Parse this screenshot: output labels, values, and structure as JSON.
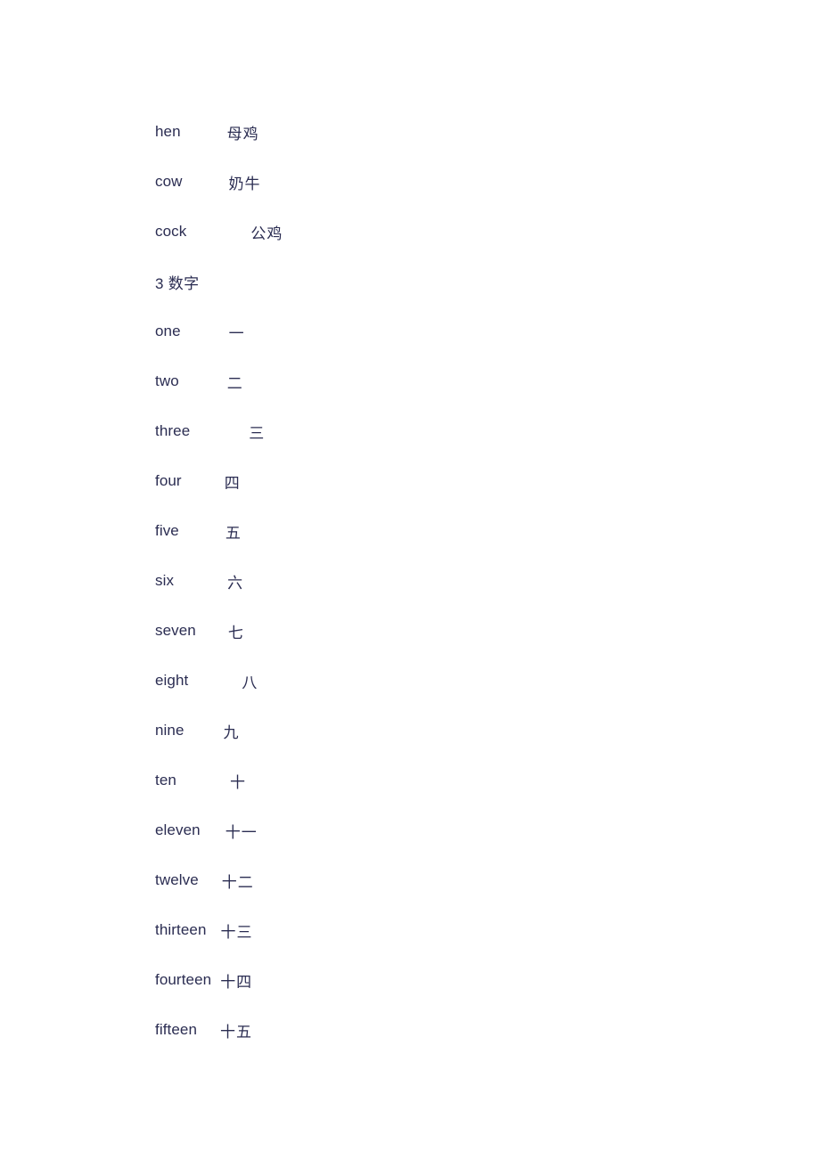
{
  "document": {
    "text_color": "#2b2d52",
    "background_color": "#ffffff",
    "blocks": [
      {
        "kind": "entry",
        "term": "hen",
        "gloss": "母鸡",
        "gap": 52
      },
      {
        "kind": "entry",
        "term": "cow",
        "gloss": "奶牛",
        "gap": 52
      },
      {
        "kind": "entry",
        "term": "cock",
        "gloss": "公鸡",
        "gap": 72
      },
      {
        "kind": "heading",
        "term": "3 数字",
        "gloss": "",
        "gap": 0
      },
      {
        "kind": "entry",
        "term": "one",
        "gloss": "一",
        "gap": 54
      },
      {
        "kind": "entry",
        "term": "two",
        "gloss": "二",
        "gap": 54
      },
      {
        "kind": "entry",
        "term": "three",
        "gloss": "三",
        "gap": 66
      },
      {
        "kind": "entry",
        "term": "four",
        "gloss": "四",
        "gap": 48
      },
      {
        "kind": "entry",
        "term": "five",
        "gloss": "五",
        "gap": 52
      },
      {
        "kind": "entry",
        "term": "six",
        "gloss": "六",
        "gap": 60
      },
      {
        "kind": "entry",
        "term": "seven",
        "gloss": "七",
        "gap": 36
      },
      {
        "kind": "entry",
        "term": "eight",
        "gloss": "八",
        "gap": 60
      },
      {
        "kind": "entry",
        "term": "nine",
        "gloss": "九",
        "gap": 44
      },
      {
        "kind": "entry",
        "term": "ten",
        "gloss": "十",
        "gap": 60
      },
      {
        "kind": "entry",
        "term": "eleven",
        "gloss": "十一",
        "gap": 28
      },
      {
        "kind": "entry",
        "term": "twelve",
        "gloss": "十二",
        "gap": 26
      },
      {
        "kind": "entry",
        "term": "thirteen",
        "gloss": "十三",
        "gap": 16
      },
      {
        "kind": "entry",
        "term": "fourteen",
        "gloss": "十四",
        "gap": 10
      },
      {
        "kind": "entry",
        "term": "fifteen",
        "gloss": "十五",
        "gap": 26
      }
    ]
  }
}
